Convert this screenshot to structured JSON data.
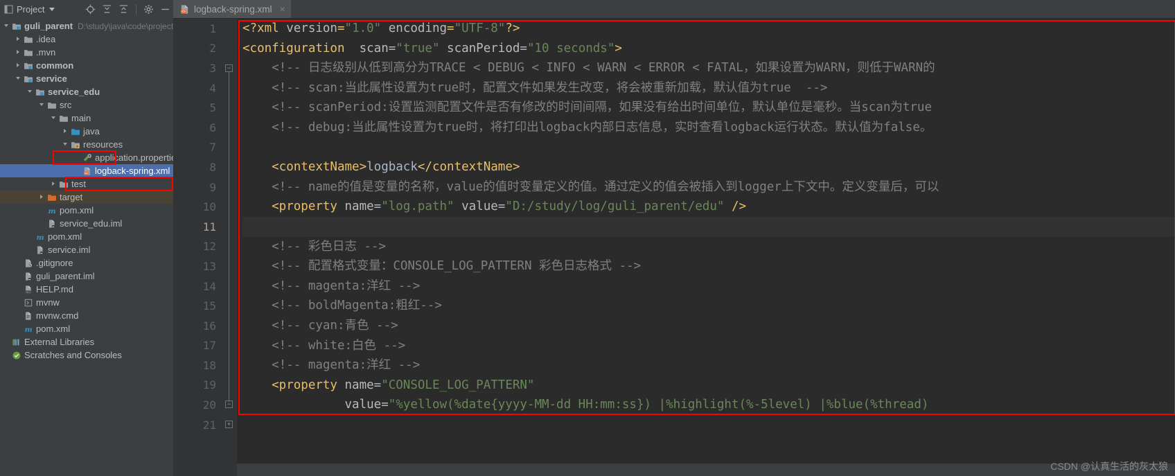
{
  "tool_window": {
    "title": "Project",
    "icons": [
      {
        "name": "locate-icon"
      },
      {
        "name": "collapse-all-icon"
      },
      {
        "name": "expand-all-icon"
      },
      {
        "name": "settings-gear-icon"
      },
      {
        "name": "hide-window-icon"
      }
    ]
  },
  "tabs": [
    {
      "label": "logback-spring.xml",
      "icon": "xml-file-icon",
      "active": true,
      "close": "×"
    }
  ],
  "tree": [
    {
      "indent": 0,
      "arrow": "down",
      "icon": "module-folder-icon",
      "label": "guli_parent",
      "bold": true,
      "sub": "D:\\study\\java\\code\\project\\guli_parent"
    },
    {
      "indent": 1,
      "arrow": "right",
      "icon": "folder-icon",
      "label": ".idea"
    },
    {
      "indent": 1,
      "arrow": "right",
      "icon": "folder-icon",
      "label": ".mvn"
    },
    {
      "indent": 1,
      "arrow": "right",
      "icon": "module-folder-icon",
      "label": "common",
      "bold": true
    },
    {
      "indent": 1,
      "arrow": "down",
      "icon": "module-folder-icon",
      "label": "service",
      "bold": true
    },
    {
      "indent": 2,
      "arrow": "down",
      "icon": "module-folder-icon",
      "label": "service_edu",
      "bold": true
    },
    {
      "indent": 3,
      "arrow": "down",
      "icon": "folder-icon",
      "label": "src"
    },
    {
      "indent": 4,
      "arrow": "down",
      "icon": "folder-icon",
      "label": "main"
    },
    {
      "indent": 5,
      "arrow": "right",
      "icon": "sources-folder-icon",
      "label": "java"
    },
    {
      "indent": 5,
      "arrow": "down",
      "icon": "resources-folder-icon",
      "label": "resources",
      "highlight_box": true
    },
    {
      "indent": 6,
      "arrow": "none",
      "icon": "properties-file-icon",
      "label": "application.properties"
    },
    {
      "indent": 6,
      "arrow": "none",
      "icon": "xml-file-icon",
      "label": "logback-spring.xml",
      "selected": true,
      "highlight_box": true
    },
    {
      "indent": 4,
      "arrow": "right",
      "icon": "folder-icon",
      "label": "test"
    },
    {
      "indent": 3,
      "arrow": "right",
      "icon": "target-folder-icon",
      "label": "target",
      "row_highlight": true
    },
    {
      "indent": 3,
      "arrow": "none",
      "icon": "maven-icon",
      "label": "pom.xml"
    },
    {
      "indent": 3,
      "arrow": "none",
      "icon": "iml-file-icon",
      "label": "service_edu.iml"
    },
    {
      "indent": 2,
      "arrow": "none",
      "icon": "maven-icon",
      "label": "pom.xml"
    },
    {
      "indent": 2,
      "arrow": "none",
      "icon": "iml-file-icon",
      "label": "service.iml"
    },
    {
      "indent": 1,
      "arrow": "none",
      "icon": "gitignore-file-icon",
      "label": ".gitignore"
    },
    {
      "indent": 1,
      "arrow": "none",
      "icon": "iml-file-icon",
      "label": "guli_parent.iml"
    },
    {
      "indent": 1,
      "arrow": "none",
      "icon": "markdown-file-icon",
      "label": "HELP.md"
    },
    {
      "indent": 1,
      "arrow": "none",
      "icon": "script-file-icon",
      "label": "mvnw"
    },
    {
      "indent": 1,
      "arrow": "none",
      "icon": "cmd-file-icon",
      "label": "mvnw.cmd"
    },
    {
      "indent": 1,
      "arrow": "none",
      "icon": "maven-icon",
      "label": "pom.xml"
    },
    {
      "indent": 0,
      "arrow": "none",
      "icon": "external-libraries-icon",
      "label": "External Libraries"
    },
    {
      "indent": 0,
      "arrow": "none",
      "icon": "scratches-icon",
      "label": "Scratches and Consoles"
    }
  ],
  "editor": {
    "first_line": 1,
    "last_line": 21,
    "current_line": 11,
    "line_numbers": [
      "1",
      "2",
      "3",
      "4",
      "5",
      "6",
      "7",
      "8",
      "9",
      "10",
      "11",
      "12",
      "13",
      "14",
      "15",
      "16",
      "17",
      "18",
      "19",
      "20",
      "21"
    ],
    "lines": [
      {
        "n": 1,
        "segs": [
          {
            "t": "pi",
            "v": "<?xml "
          },
          {
            "t": "attr",
            "v": "version"
          },
          {
            "t": "pi",
            "v": "="
          },
          {
            "t": "str",
            "v": "\"1.0\""
          },
          {
            "t": "attr",
            "v": " encoding"
          },
          {
            "t": "pi",
            "v": "="
          },
          {
            "t": "str",
            "v": "\"UTF-8\""
          },
          {
            "t": "pi",
            "v": "?>"
          }
        ]
      },
      {
        "n": 2,
        "segs": [
          {
            "t": "tag",
            "v": "<configuration"
          },
          {
            "t": "attr",
            "v": "  scan"
          },
          {
            "t": "txtv",
            "v": "="
          },
          {
            "t": "str",
            "v": "\"true\""
          },
          {
            "t": "attr",
            "v": " scanPeriod"
          },
          {
            "t": "txtv",
            "v": "="
          },
          {
            "t": "str",
            "v": "\"10 seconds\""
          },
          {
            "t": "tag",
            "v": ">"
          }
        ]
      },
      {
        "n": 3,
        "segs": [
          {
            "t": "cmt",
            "v": "    <!-- 日志级别从低到高分为TRACE < DEBUG < INFO < WARN < ERROR < FATAL，如果设置为WARN，则低于WARN的"
          }
        ]
      },
      {
        "n": 4,
        "segs": [
          {
            "t": "cmt",
            "v": "    <!-- scan:当此属性设置为true时，配置文件如果发生改变，将会被重新加载，默认值为true  -->"
          }
        ]
      },
      {
        "n": 5,
        "segs": [
          {
            "t": "cmt",
            "v": "    <!-- scanPeriod:设置监测配置文件是否有修改的时间间隔，如果没有给出时间单位，默认单位是毫秒。当scan为true"
          }
        ]
      },
      {
        "n": 6,
        "segs": [
          {
            "t": "cmt",
            "v": "    <!-- debug:当此属性设置为true时，将打印出logback内部日志信息，实时查看logback运行状态。默认值为false。"
          }
        ]
      },
      {
        "n": 7,
        "segs": []
      },
      {
        "n": 8,
        "segs": [
          {
            "t": "tag",
            "v": "    <contextName>"
          },
          {
            "t": "txtv",
            "v": "logback"
          },
          {
            "t": "tag",
            "v": "</contextName>"
          }
        ]
      },
      {
        "n": 9,
        "segs": [
          {
            "t": "cmt",
            "v": "    <!-- name的值是变量的名称，value的值时变量定义的值。通过定义的值会被插入到logger上下文中。定义变量后，可以"
          }
        ]
      },
      {
        "n": 10,
        "segs": [
          {
            "t": "tag",
            "v": "    <property"
          },
          {
            "t": "attr",
            "v": " name"
          },
          {
            "t": "txtv",
            "v": "="
          },
          {
            "t": "str",
            "v": "\"log.path\""
          },
          {
            "t": "attr",
            "v": " value"
          },
          {
            "t": "txtv",
            "v": "="
          },
          {
            "t": "str",
            "v": "\"D:/study/log/guli_parent/edu\""
          },
          {
            "t": "tag",
            "v": " />"
          }
        ]
      },
      {
        "n": 11,
        "segs": []
      },
      {
        "n": 12,
        "segs": [
          {
            "t": "cmt",
            "v": "    <!-- 彩色日志 -->"
          }
        ]
      },
      {
        "n": 13,
        "segs": [
          {
            "t": "cmt",
            "v": "    <!-- 配置格式变量：CONSOLE_LOG_PATTERN 彩色日志格式 -->"
          }
        ]
      },
      {
        "n": 14,
        "segs": [
          {
            "t": "cmt",
            "v": "    <!-- magenta:洋红 -->"
          }
        ]
      },
      {
        "n": 15,
        "segs": [
          {
            "t": "cmt",
            "v": "    <!-- boldMagenta:粗红-->"
          }
        ]
      },
      {
        "n": 16,
        "segs": [
          {
            "t": "cmt",
            "v": "    <!-- cyan:青色 -->"
          }
        ]
      },
      {
        "n": 17,
        "segs": [
          {
            "t": "cmt",
            "v": "    <!-- white:白色 -->"
          }
        ]
      },
      {
        "n": 18,
        "segs": [
          {
            "t": "cmt",
            "v": "    <!-- magenta:洋红 -->"
          }
        ]
      },
      {
        "n": 19,
        "segs": [
          {
            "t": "tag",
            "v": "    <property"
          },
          {
            "t": "attr",
            "v": " name"
          },
          {
            "t": "txtv",
            "v": "="
          },
          {
            "t": "str",
            "v": "\"CONSOLE_LOG_PATTERN\""
          }
        ]
      },
      {
        "n": 20,
        "segs": [
          {
            "t": "attr",
            "v": "              value"
          },
          {
            "t": "txtv",
            "v": "="
          },
          {
            "t": "str",
            "v": "\"%yellow(%date{yyyy-MM-dd HH:mm:ss}) |%highlight(%-5level) |%blue(%thread)"
          }
        ]
      },
      {
        "n": 21,
        "segs": []
      }
    ]
  },
  "watermark": {
    "text": "CSDN @认真生活的灰太狼"
  },
  "colors": {
    "accent_red": "#ff0000",
    "selection_blue": "#4b6eaf",
    "editor_bg": "#2b2b2b",
    "panel_bg": "#3c3f41",
    "gutter_bg": "#313335",
    "comment": "#808080",
    "tag": "#e8bf6a",
    "string": "#6a8759",
    "text_value": "#a9b7c6"
  }
}
